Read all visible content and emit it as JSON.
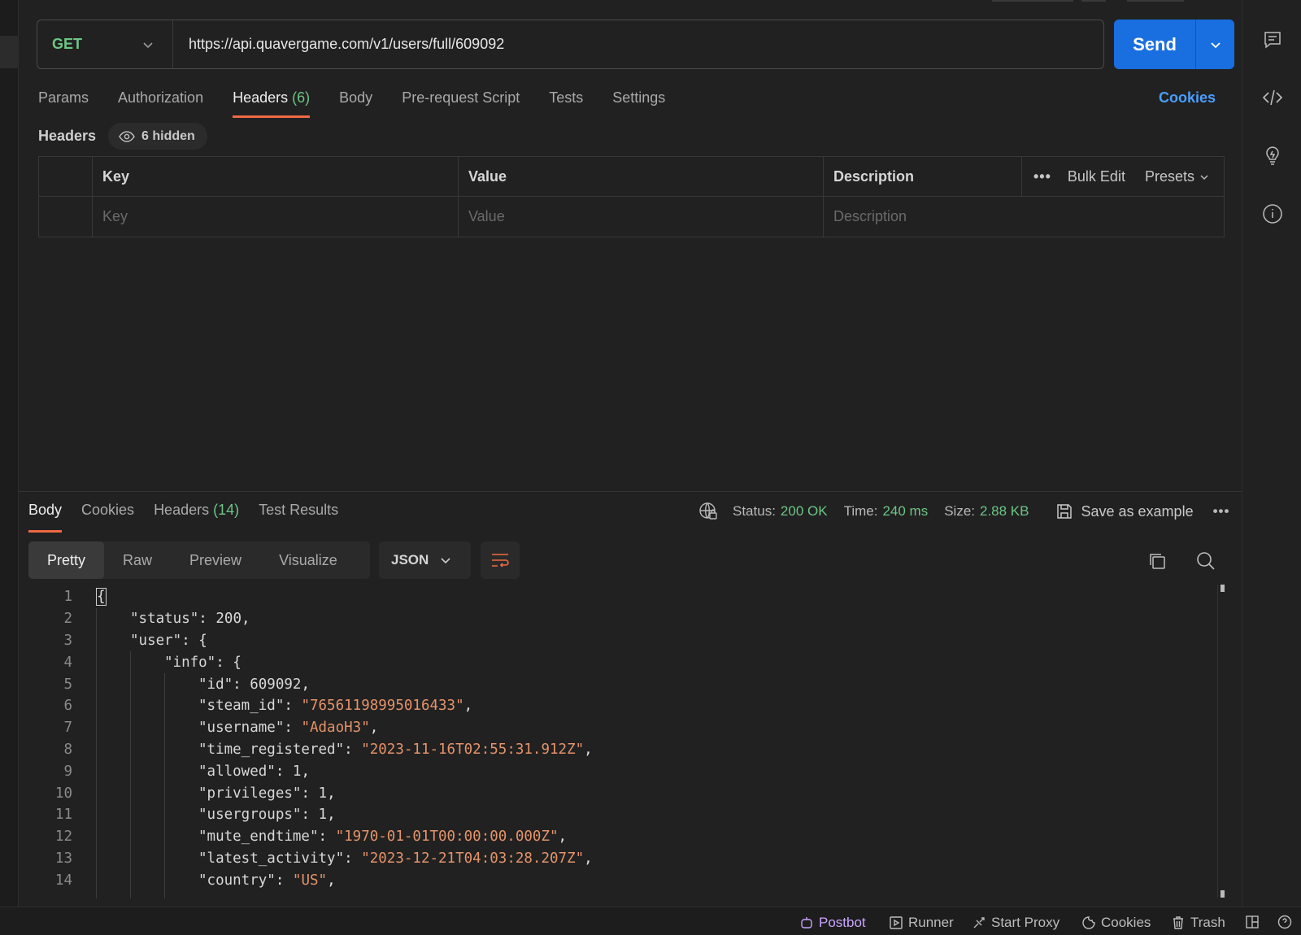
{
  "request": {
    "method": "GET",
    "url": "https://api.quavergame.com/v1/users/full/609092",
    "send_label": "Send",
    "tabs": [
      {
        "label": "Params",
        "count": ""
      },
      {
        "label": "Authorization",
        "count": ""
      },
      {
        "label": "Headers",
        "count": "(6)"
      },
      {
        "label": "Body",
        "count": ""
      },
      {
        "label": "Pre-request Script",
        "count": ""
      },
      {
        "label": "Tests",
        "count": ""
      },
      {
        "label": "Settings",
        "count": ""
      }
    ],
    "active_tab": "Headers",
    "cookies_link": "Cookies"
  },
  "headers_section": {
    "title": "Headers",
    "hidden_label": "6 hidden",
    "columns": {
      "key": "Key",
      "value": "Value",
      "description": "Description"
    },
    "placeholders": {
      "key": "Key",
      "value": "Value",
      "description": "Description"
    },
    "tools": {
      "more": "•••",
      "bulk_edit": "Bulk Edit",
      "presets": "Presets"
    }
  },
  "response": {
    "tabs": [
      {
        "label": "Body",
        "count": ""
      },
      {
        "label": "Cookies",
        "count": ""
      },
      {
        "label": "Headers",
        "count": "(14)"
      },
      {
        "label": "Test Results",
        "count": ""
      }
    ],
    "status_label": "Status:",
    "status_value": "200 OK",
    "time_label": "Time:",
    "time_value": "240 ms",
    "size_label": "Size:",
    "size_value": "2.88 KB",
    "save_example": "Save as example",
    "more": "•••",
    "modes": [
      "Pretty",
      "Raw",
      "Preview",
      "Visualize"
    ],
    "active_mode": "Pretty",
    "format": "JSON",
    "code_lines": [
      {
        "n": "1",
        "indent": 0,
        "parts": [
          {
            "t": "p",
            "v": "{"
          }
        ]
      },
      {
        "n": "2",
        "indent": 1,
        "parts": [
          {
            "t": "k",
            "v": "\"status\""
          },
          {
            "t": "p",
            "v": ": "
          },
          {
            "t": "n",
            "v": "200"
          },
          {
            "t": "p",
            "v": ","
          }
        ]
      },
      {
        "n": "3",
        "indent": 1,
        "parts": [
          {
            "t": "k",
            "v": "\"user\""
          },
          {
            "t": "p",
            "v": ": {"
          }
        ]
      },
      {
        "n": "4",
        "indent": 2,
        "parts": [
          {
            "t": "k",
            "v": "\"info\""
          },
          {
            "t": "p",
            "v": ": {"
          }
        ]
      },
      {
        "n": "5",
        "indent": 3,
        "parts": [
          {
            "t": "k",
            "v": "\"id\""
          },
          {
            "t": "p",
            "v": ": "
          },
          {
            "t": "n",
            "v": "609092"
          },
          {
            "t": "p",
            "v": ","
          }
        ]
      },
      {
        "n": "6",
        "indent": 3,
        "parts": [
          {
            "t": "k",
            "v": "\"steam_id\""
          },
          {
            "t": "p",
            "v": ": "
          },
          {
            "t": "s",
            "v": "\"76561198995016433\""
          },
          {
            "t": "p",
            "v": ","
          }
        ]
      },
      {
        "n": "7",
        "indent": 3,
        "parts": [
          {
            "t": "k",
            "v": "\"username\""
          },
          {
            "t": "p",
            "v": ": "
          },
          {
            "t": "s",
            "v": "\"AdaoH3\""
          },
          {
            "t": "p",
            "v": ","
          }
        ]
      },
      {
        "n": "8",
        "indent": 3,
        "parts": [
          {
            "t": "k",
            "v": "\"time_registered\""
          },
          {
            "t": "p",
            "v": ": "
          },
          {
            "t": "s",
            "v": "\"2023-11-16T02:55:31.912Z\""
          },
          {
            "t": "p",
            "v": ","
          }
        ]
      },
      {
        "n": "9",
        "indent": 3,
        "parts": [
          {
            "t": "k",
            "v": "\"allowed\""
          },
          {
            "t": "p",
            "v": ": "
          },
          {
            "t": "n",
            "v": "1"
          },
          {
            "t": "p",
            "v": ","
          }
        ]
      },
      {
        "n": "10",
        "indent": 3,
        "parts": [
          {
            "t": "k",
            "v": "\"privileges\""
          },
          {
            "t": "p",
            "v": ": "
          },
          {
            "t": "n",
            "v": "1"
          },
          {
            "t": "p",
            "v": ","
          }
        ]
      },
      {
        "n": "11",
        "indent": 3,
        "parts": [
          {
            "t": "k",
            "v": "\"usergroups\""
          },
          {
            "t": "p",
            "v": ": "
          },
          {
            "t": "n",
            "v": "1"
          },
          {
            "t": "p",
            "v": ","
          }
        ]
      },
      {
        "n": "12",
        "indent": 3,
        "parts": [
          {
            "t": "k",
            "v": "\"mute_endtime\""
          },
          {
            "t": "p",
            "v": ": "
          },
          {
            "t": "s",
            "v": "\"1970-01-01T00:00:00.000Z\""
          },
          {
            "t": "p",
            "v": ","
          }
        ]
      },
      {
        "n": "13",
        "indent": 3,
        "parts": [
          {
            "t": "k",
            "v": "\"latest_activity\""
          },
          {
            "t": "p",
            "v": ": "
          },
          {
            "t": "s",
            "v": "\"2023-12-21T04:03:28.207Z\""
          },
          {
            "t": "p",
            "v": ","
          }
        ]
      },
      {
        "n": "14",
        "indent": 3,
        "parts": [
          {
            "t": "k",
            "v": "\"country\""
          },
          {
            "t": "p",
            "v": ": "
          },
          {
            "t": "s",
            "v": "\"US\""
          },
          {
            "t": "p",
            "v": ","
          }
        ]
      }
    ]
  },
  "statusbar": {
    "postbot": "Postbot",
    "runner": "Runner",
    "start_proxy": "Start Proxy",
    "cookies": "Cookies",
    "trash": "Trash"
  },
  "colors": {
    "accent_blue": "#1a6fe0",
    "active_underline": "#ef6a43",
    "success_green": "#6cc685",
    "string_orange": "#e4936a",
    "link_blue": "#4a9eff"
  },
  "icons": [
    "comment-icon",
    "code-icon",
    "lightbulb-icon",
    "info-icon",
    "eye-icon",
    "globe-icon",
    "save-icon",
    "copy-icon",
    "search-icon",
    "wrap-icon",
    "chevron-down-icon"
  ]
}
